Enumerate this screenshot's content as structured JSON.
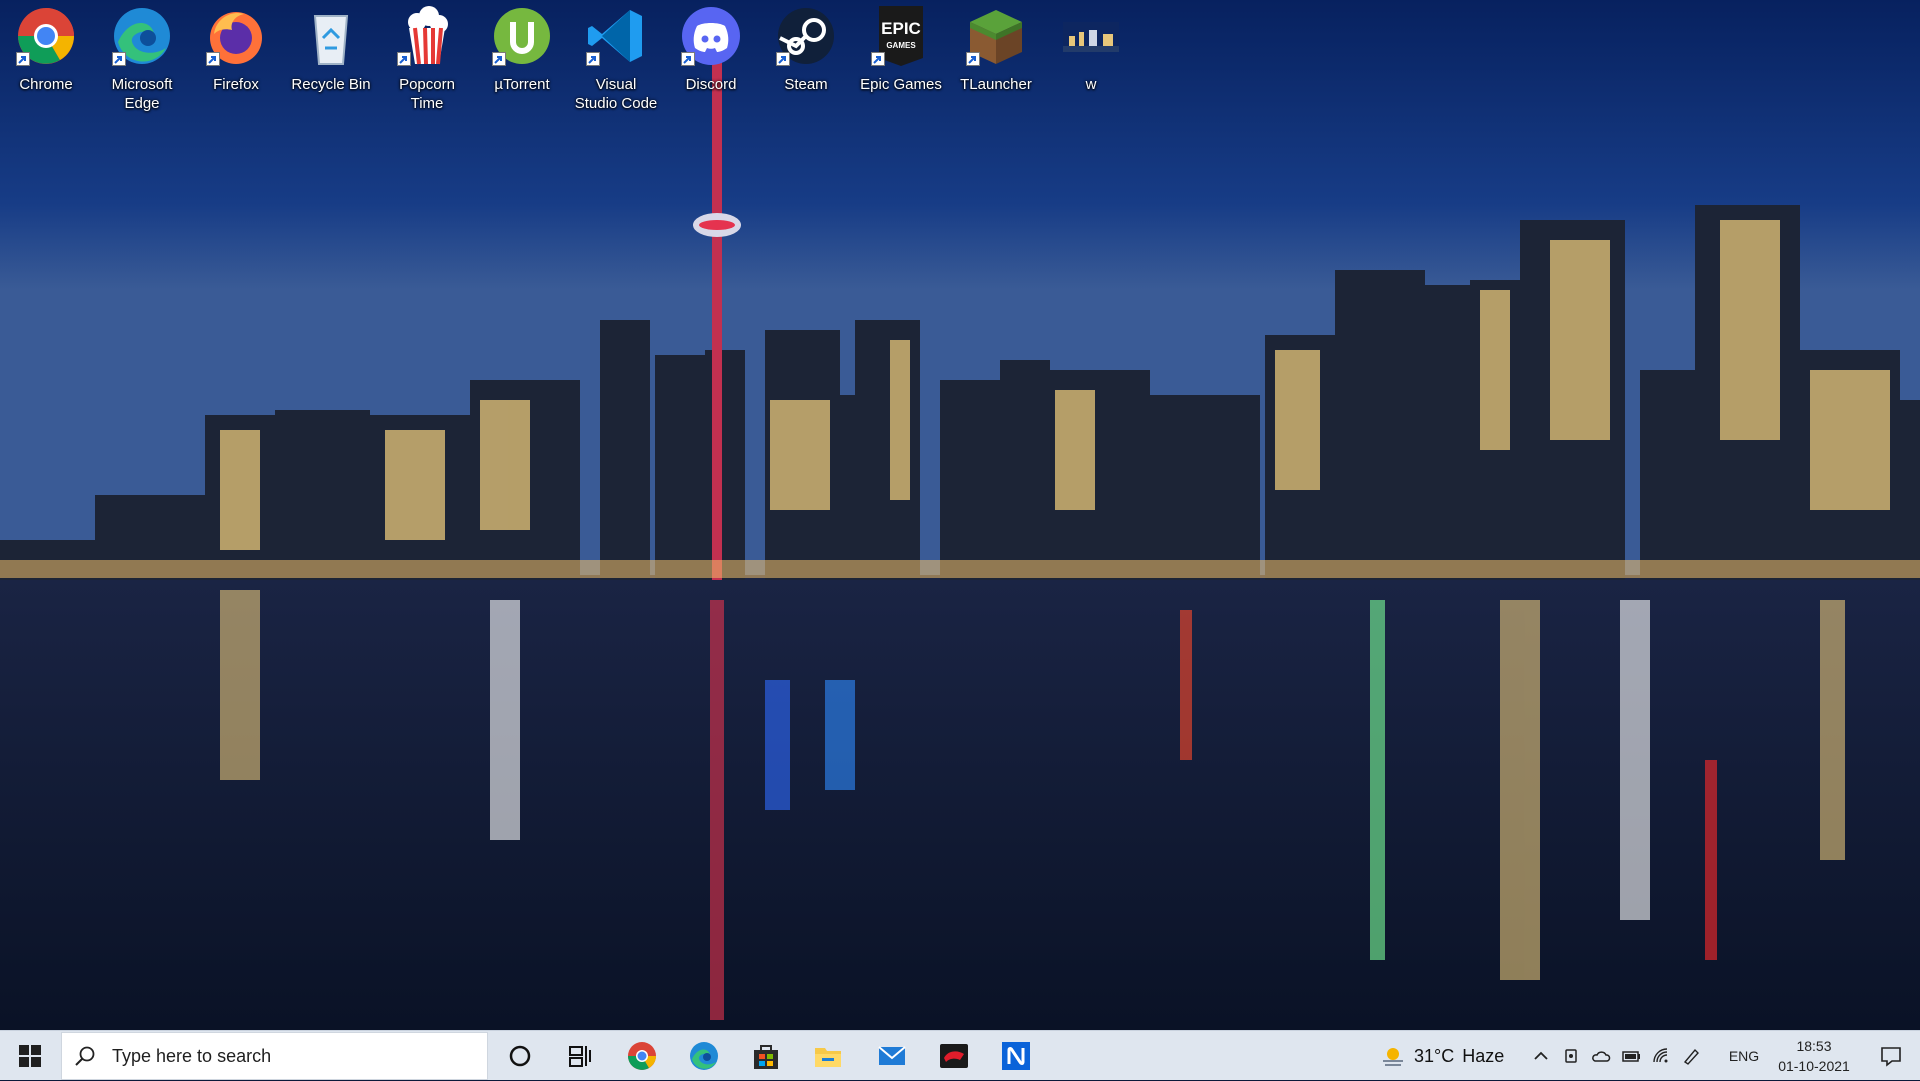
{
  "desktop": {
    "icons": [
      {
        "label": "Chrome",
        "icon": "chrome-icon",
        "shortcut": true
      },
      {
        "label": "Microsoft Edge",
        "icon": "edge-icon",
        "shortcut": true
      },
      {
        "label": "Firefox",
        "icon": "firefox-icon",
        "shortcut": true
      },
      {
        "label": "Recycle Bin",
        "icon": "recycle-bin-icon",
        "shortcut": false
      },
      {
        "label": "Popcorn Time",
        "icon": "popcorn-icon",
        "shortcut": true
      },
      {
        "label": "µTorrent",
        "icon": "utorrent-icon",
        "shortcut": true
      },
      {
        "label": "Visual Studio Code",
        "icon": "vscode-icon",
        "shortcut": true
      },
      {
        "label": "Discord",
        "icon": "discord-icon",
        "shortcut": true
      },
      {
        "label": "Steam",
        "icon": "steam-icon",
        "shortcut": true
      },
      {
        "label": "Epic Games",
        "icon": "epic-games-icon",
        "shortcut": true
      },
      {
        "label": "TLauncher",
        "icon": "tlauncher-icon",
        "shortcut": true
      },
      {
        "label": "w",
        "icon": "image-file-icon",
        "shortcut": false
      }
    ],
    "epic_logo_text": "EPIC",
    "epic_logo_sub": "GAMES"
  },
  "taskbar": {
    "search_placeholder": "Type here to search",
    "pinned_apps": [
      "cortana-icon",
      "task-view-icon",
      "chrome-icon",
      "edge-icon",
      "store-icon",
      "file-explorer-icon",
      "mail-icon",
      "app-red-icon",
      "app-blue-n-icon"
    ],
    "weather": {
      "temp": "31°C",
      "condition": "Haze"
    },
    "language": "ENG",
    "time": "18:53",
    "date": "01-10-2021"
  },
  "colors": {
    "taskbar_bg": "#dfe6ef",
    "sky_top": "#0a1f5c",
    "water": "#0b1530"
  }
}
